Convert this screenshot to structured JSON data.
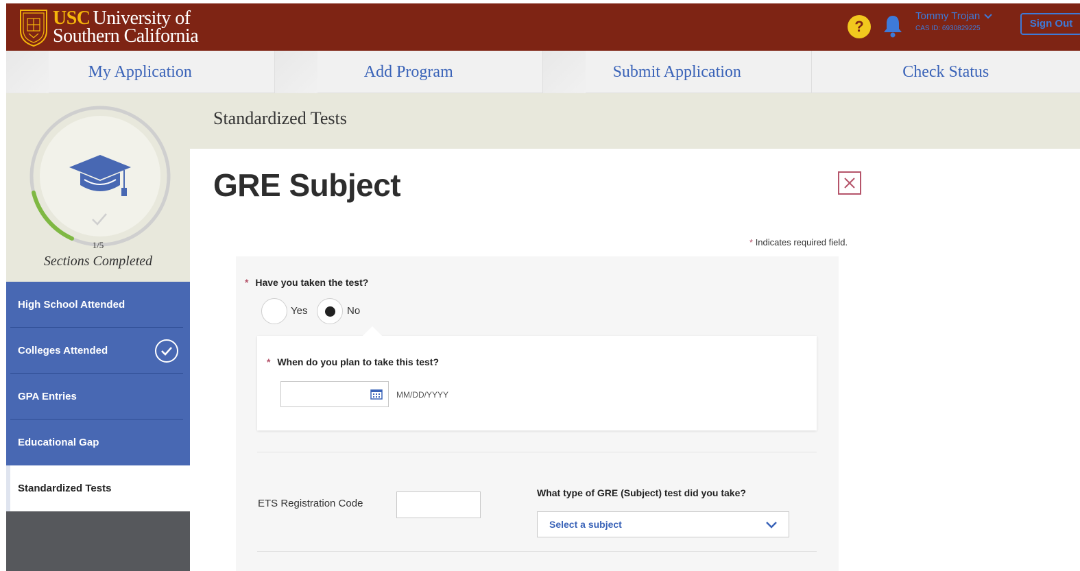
{
  "header": {
    "logo_usc": "USC",
    "logo_university": "University of",
    "logo_line2": "Southern California",
    "help_symbol": "?",
    "user_name": "Tommy Trojan",
    "cas_id": "CAS ID: 6930829225",
    "sign_out_label": "Sign Out",
    "colors": {
      "brand": "#7e2414",
      "gold": "#f2c81e",
      "accent": "#3e7ad9"
    }
  },
  "nav": {
    "tabs": [
      {
        "label": "My Application"
      },
      {
        "label": "Add Program"
      },
      {
        "label": "Submit Application"
      },
      {
        "label": "Check Status"
      }
    ]
  },
  "progress": {
    "fraction": "1/5",
    "completed": 1,
    "total": 5,
    "label": "Sections Completed"
  },
  "sidebar": {
    "items": [
      {
        "label": "High School Attended"
      },
      {
        "label": "Colleges Attended"
      },
      {
        "label": "GPA Entries"
      },
      {
        "label": "Educational Gap"
      },
      {
        "label": "Standardized Tests"
      }
    ]
  },
  "main": {
    "section_title": "Standardized Tests",
    "page_title": "GRE Subject",
    "required_star": "*",
    "required_note": "Indicates required field.",
    "q_taken": "Have you taken the test?",
    "option_yes": "Yes",
    "option_no": "No",
    "selected_option": "No",
    "q_plan": "When do you plan to take this test?",
    "date_value": "",
    "date_hint": "MM/DD/YYYY",
    "ets_label": "ETS Registration Code",
    "ets_value": "",
    "q_type": "What type of GRE (Subject) test did you take?",
    "subject_placeholder": "Select a subject"
  }
}
